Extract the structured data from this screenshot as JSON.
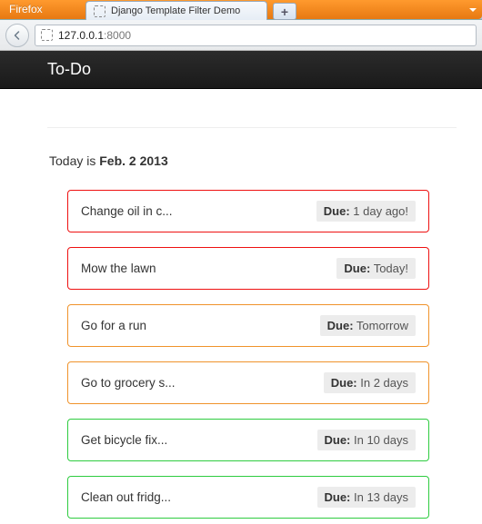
{
  "browser": {
    "app_button": "Firefox",
    "tab_title": "Django Template Filter Demo",
    "new_tab_glyph": "+",
    "url_host": "127.0.0.1",
    "url_port": ":8000"
  },
  "header": {
    "title": "To-Do"
  },
  "today": {
    "prefix": "Today is ",
    "date": "Feb. 2 2013"
  },
  "due_label": "Due:",
  "items": [
    {
      "title": "Change oil in c...",
      "due": "1 day ago!",
      "status": "red"
    },
    {
      "title": "Mow the lawn",
      "due": "Today!",
      "status": "red"
    },
    {
      "title": "Go for a run",
      "due": "Tomorrow",
      "status": "orange"
    },
    {
      "title": "Go to grocery s...",
      "due": "In 2 days",
      "status": "orange"
    },
    {
      "title": "Get bicycle fix...",
      "due": "In 10 days",
      "status": "green"
    },
    {
      "title": "Clean out fridg...",
      "due": "In 13 days",
      "status": "green"
    }
  ]
}
